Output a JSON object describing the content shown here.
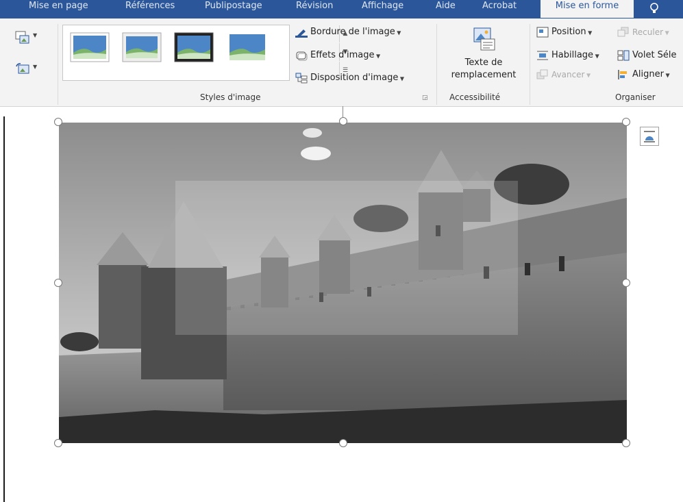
{
  "tabs": [
    {
      "label": "Mise en page"
    },
    {
      "label": "Références"
    },
    {
      "label": "Publipostage"
    },
    {
      "label": "Révision"
    },
    {
      "label": "Affichage"
    },
    {
      "label": "Aide"
    },
    {
      "label": "Acrobat"
    },
    {
      "label": "Mise en forme"
    }
  ],
  "active_tab_index": 7,
  "ribbon": {
    "picture_styles": {
      "group_label": "Styles d'image",
      "border_label": "Bordure de l'image",
      "effects_label": "Effets d'image",
      "layout_label": "Disposition d'image"
    },
    "accessibility": {
      "button_line1": "Texte de",
      "button_line2": "remplacement",
      "group_label": "Accessibilité"
    },
    "arrange": {
      "position_label": "Position",
      "wrap_label": "Habillage",
      "forward_label": "Avancer",
      "backward_label": "Reculer",
      "selection_pane_label": "Volet Séle",
      "align_label": "Aligner",
      "group_label": "Organiser"
    }
  },
  "colors": {
    "tab_bar": "#2b579a",
    "ribbon_bg": "#f3f3f3",
    "accent_blue": "#2b579a"
  },
  "icons": {
    "compress": "compress-pictures-icon",
    "reset": "reset-picture-icon",
    "border": "picture-border-icon",
    "effects": "picture-effects-icon",
    "layout": "picture-layout-icon",
    "alt_text": "alt-text-icon",
    "position": "position-icon",
    "wrap": "wrap-text-icon",
    "forward": "bring-forward-icon",
    "backward": "send-backward-icon",
    "selection": "selection-pane-icon",
    "align": "align-icon",
    "layout_options": "layout-options-icon"
  },
  "document": {
    "image": "castle-photo"
  }
}
